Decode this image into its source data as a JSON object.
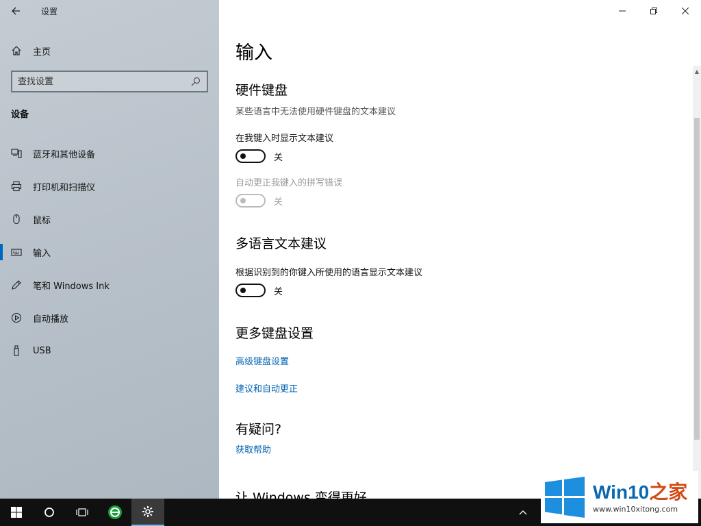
{
  "window": {
    "title": "设置"
  },
  "sidebar": {
    "home_label": "主页",
    "search_placeholder": "查找设置",
    "section_label": "设备",
    "items": [
      {
        "label": "蓝牙和其他设备",
        "icon": "bluetooth-devices-icon"
      },
      {
        "label": "打印机和扫描仪",
        "icon": "printer-icon"
      },
      {
        "label": "鼠标",
        "icon": "mouse-icon"
      },
      {
        "label": "输入",
        "icon": "keyboard-icon",
        "active": true
      },
      {
        "label": "笔和 Windows Ink",
        "icon": "pen-icon"
      },
      {
        "label": "自动播放",
        "icon": "autoplay-icon"
      },
      {
        "label": "USB",
        "icon": "usb-icon"
      }
    ]
  },
  "content": {
    "page_title": "输入",
    "hardware": {
      "heading": "硬件键盘",
      "description": "某些语言中无法使用硬件键盘的文本建议",
      "setting1_label": "在我键入时显示文本建议",
      "setting1_state": "关",
      "setting2_label": "自动更正我键入的拼写错误",
      "setting2_state": "关"
    },
    "multilang": {
      "heading": "多语言文本建议",
      "setting_label": "根据识别到的你键入所使用的语言显示文本建议",
      "setting_state": "关"
    },
    "more": {
      "heading": "更多键盘设置",
      "link1": "高级键盘设置",
      "link2": "建议和自动更正"
    },
    "question": {
      "heading": "有疑问?",
      "link": "获取帮助"
    },
    "improve": {
      "heading": "让 Windows 变得更好"
    }
  },
  "watermark": {
    "title_prefix": "Win10",
    "title_suffix": "之家",
    "url": "www.win10xitong.com"
  }
}
